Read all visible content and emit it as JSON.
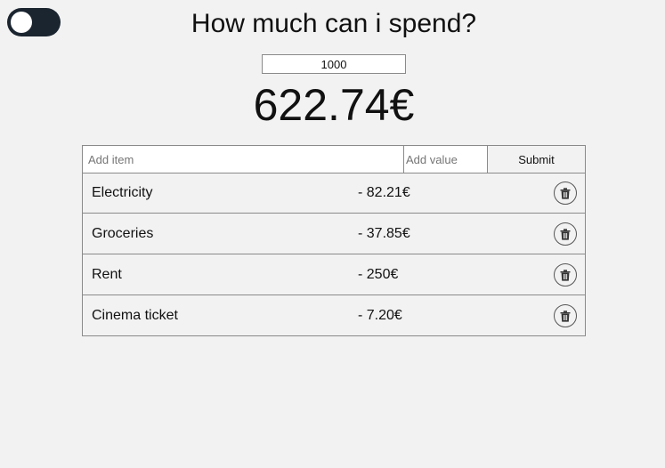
{
  "header": {
    "title": "How much can i spend?"
  },
  "theme_toggle": {
    "state": "off"
  },
  "budget": {
    "value": "1000"
  },
  "remaining": "622.74€",
  "form": {
    "item_placeholder": "Add item",
    "value_placeholder": "Add value",
    "submit_label": "Submit"
  },
  "expenses": [
    {
      "name": "Electricity",
      "amount": "- 82.21€"
    },
    {
      "name": "Groceries",
      "amount": "- 37.85€"
    },
    {
      "name": "Rent",
      "amount": "- 250€"
    },
    {
      "name": "Cinema ticket",
      "amount": "- 7.20€"
    }
  ],
  "icons": {
    "delete": "trash-icon"
  },
  "colors": {
    "background": "#f2f2f2",
    "toggle_track": "#1b2530",
    "border": "#8a8a8a"
  }
}
